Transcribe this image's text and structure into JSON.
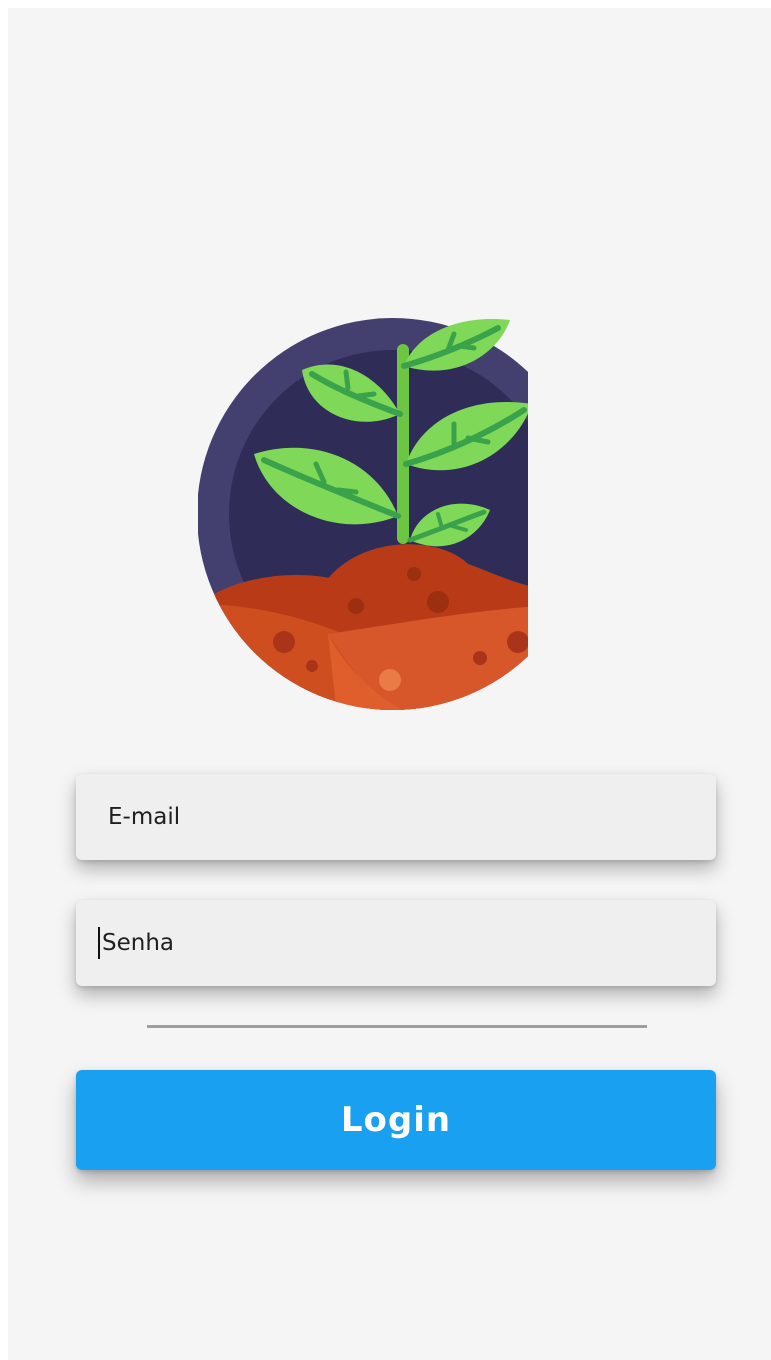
{
  "logo": {
    "icon": "plant-sprout-logo-icon",
    "colors": {
      "outer_ring": "#433f6e",
      "inner_sky": "#2f2d57",
      "soil_dark": "#b93a17",
      "soil_mid": "#cf4e20",
      "soil_light": "#e0612e",
      "stem": "#6cc644",
      "leaf": "#7fd857",
      "leaf_dark": "#5bb83a",
      "vein": "#3aa24b"
    }
  },
  "form": {
    "email": {
      "placeholder": "E-mail",
      "value": ""
    },
    "password": {
      "placeholder": "Senha",
      "value": "",
      "focused": true
    },
    "login_label": "Login"
  },
  "colors": {
    "background": "#f5f5f5",
    "field_background": "#efefef",
    "primary_button": "#1aa0f0",
    "divider": "#9e9e9e"
  }
}
